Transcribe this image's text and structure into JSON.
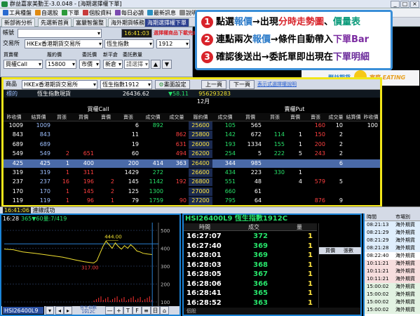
{
  "window": {
    "title": "群益嘉家美動王-3.0.048 - [海期選擇權下單]",
    "controls": [
      "_",
      "□",
      "×"
    ]
  },
  "menu": [
    {
      "label": "工具種盤",
      "color": "#2a6bd0"
    },
    {
      "label": "自選股",
      "color": "#e08a10"
    },
    {
      "label": "下單",
      "color": "#2c9a3a"
    },
    {
      "label": "個股資料",
      "color": "#c83a3a"
    },
    {
      "label": "每日必讀",
      "color": "#7a4ab0"
    },
    {
      "label": "最新訊息",
      "color": "#2a8fbf"
    },
    {
      "label": "說明",
      "color": "#888888"
    },
    {
      "label": "頁面",
      "color": "#3a7ad0"
    },
    {
      "label": "超光速下單",
      "color": "#d8232a"
    }
  ],
  "toolbar": [
    "☆",
    "雲端",
    "🔳",
    "☆"
  ],
  "tabs": [
    "新部術分析",
    "先選新首頁",
    "富嚴智盤整",
    "海外期貨帳務",
    "海期選擇權下單"
  ],
  "order": {
    "account_label": "帳號",
    "account_value": "",
    "exchange_label": "交易所",
    "exchange_value": "HKEx香港期貨交易所",
    "product_label": "恆生指數",
    "month_value": "1912",
    "warning": "選擇權商品下載完成",
    "time": "16:41:03",
    "col_labels": [
      "買賣權",
      "履約價",
      "委託價",
      "新平倉",
      "委託數量"
    ],
    "side": "買權Call",
    "strike": "15800",
    "price_type": "市價",
    "offset": "新倉",
    "qty_placeholder": "請選擇"
  },
  "tip": {
    "lines": [
      {
        "n": "1",
        "pre": "點選",
        "hl1": "報價",
        "mid": "→出現",
        "hl2": "分時走勢圖",
        "sep": "、",
        "hl3": "價量表",
        "post": ""
      },
      {
        "n": "2",
        "pre": "連點兩次",
        "hl1": "報價",
        "mid": "→條件自動帶入",
        "hl2": "下單Bar",
        "sep": "",
        "hl3": "",
        "post": ""
      },
      {
        "n": "3",
        "pre": "確認後送出→委託單即出現在",
        "hl1": "下單明細",
        "mid": "",
        "hl2": "",
        "sep": "",
        "hl3": "",
        "post": ""
      }
    ]
  },
  "brand": {
    "left": "群益期貨",
    "right": "富庭",
    "eat": "EATING"
  },
  "quote": {
    "prod_label": "商品",
    "exchange": "HKEx香港期貨交易所",
    "index_name": "恆生指數1912",
    "settings": "畫面設定",
    "prev": "上一頁",
    "next": "下一頁",
    "expand": "表示式選擇權說明",
    "underlying_label": "標的",
    "underlying_name": "恆生指數現貨",
    "underlying_price": "26436.62",
    "underlying_chg": "▼58.11",
    "underlying_vol": "956293283",
    "month": "12月",
    "call_label": "買權Call",
    "put_label": "賣權Put",
    "headers": [
      "昨收價",
      "結算價",
      "買張",
      "買價",
      "賣價",
      "賣張",
      "成交價",
      "成交量",
      "履約價",
      "成交價",
      "買價",
      "買張",
      "賣價",
      "賣張",
      "成交量",
      "結算價",
      "昨收價"
    ],
    "rows": [
      {
        "a": "1009",
        "b": "1009",
        "c": "",
        "d": "",
        "e": "",
        "f": "6",
        "g": "892",
        "h": "",
        "strike": "25600",
        "i": "105",
        "j": "565",
        "k": "",
        "l": "",
        "m": "160",
        "n": "10",
        "o": "",
        "p": "100",
        "q": "100"
      },
      {
        "a": "843",
        "b": "843",
        "c": "",
        "d": "",
        "e": "",
        "f": "11",
        "g": "",
        "h": "862",
        "strike": "25800",
        "i": "142",
        "j": "672",
        "k": "114",
        "l": "1",
        "m": "150",
        "n": "2",
        "o": "",
        "p": "",
        "q": "142"
      },
      {
        "a": "689",
        "b": "689",
        "c": "",
        "d": "",
        "e": "",
        "f": "19",
        "g": "",
        "h": "631",
        "strike": "26000",
        "i": "193",
        "j": "1334",
        "k": "155",
        "l": "1",
        "m": "200",
        "n": "2",
        "o": "",
        "p": "",
        "q": "193"
      },
      {
        "a": "549",
        "b": "549",
        "c": "2",
        "d": "651",
        "e": "",
        "f": "60",
        "g": "",
        "h": "494",
        "strike": "26200",
        "i": "254",
        "j": "5",
        "k": "222",
        "l": "5",
        "m": "243",
        "n": "2",
        "o": "",
        "p": "",
        "q": "254"
      },
      {
        "a": "425",
        "b": "425",
        "c": "1",
        "d": "400",
        "e": "",
        "f": "200",
        "g": "414",
        "h": "363",
        "strike": "26400",
        "i": "344",
        "j": "985",
        "k": "",
        "l": "",
        "m": "",
        "n": "6",
        "o": "",
        "p": "",
        "q": "310"
      },
      {
        "a": "319",
        "b": "319",
        "c": "1",
        "d": "311",
        "e": "",
        "f": "1429",
        "g": "272",
        "h": "",
        "strike": "26600",
        "i": "434",
        "j": "223",
        "k": "330",
        "l": "1",
        "m": "",
        "n": "",
        "o": "",
        "p": "",
        "q": "434"
      },
      {
        "a": "237",
        "b": "237",
        "c": "16",
        "d": "196",
        "e": "2",
        "f": "145",
        "g": "1142",
        "h": "192",
        "strike": "26800",
        "i": "551",
        "j": "48",
        "k": "",
        "l": "4",
        "m": "579",
        "n": "5",
        "o": "",
        "p": "",
        "q": "525"
      },
      {
        "a": "170",
        "b": "170",
        "c": "1",
        "d": "145",
        "e": "2",
        "f": "125",
        "g": "1300",
        "h": "",
        "strike": "27000",
        "i": "660",
        "j": "61",
        "k": "",
        "l": "",
        "m": "",
        "n": "",
        "o": "",
        "p": "",
        "q": "660"
      },
      {
        "a": "119",
        "b": "119",
        "c": "1",
        "d": "96",
        "e": "1",
        "f": "79",
        "g": "1759",
        "h": "90",
        "strike": "27200",
        "i": "795",
        "j": "64",
        "k": "",
        "l": "",
        "m": "876",
        "n": "9",
        "o": "",
        "p": "",
        "q": "805"
      }
    ]
  },
  "status": {
    "time": "16:41:06",
    "text": "連線成功"
  },
  "chart": {
    "header_time": "16:28",
    "header_info": "365▼60量:7/419",
    "high_label": "444.00",
    "low_label": "317.00",
    "y_ticks": [
      "500",
      "400",
      "300",
      "200",
      "100"
    ],
    "symbol": "HSI26400L9",
    "index_name": "恆生指數",
    "index_month": "1912C",
    "zoom_buttons": [
      "—",
      "+",
      "T",
      "F",
      "≡",
      "日",
      "⌂"
    ]
  },
  "ticks": {
    "title": "HSI26400L9 恆生指數1912C",
    "headers": [
      "時間",
      "成交",
      "量"
    ],
    "rows": [
      {
        "t": "16:27:07",
        "p": "372",
        "v": "1"
      },
      {
        "t": "16:27:40",
        "p": "369",
        "v": "1"
      },
      {
        "t": "16:28:01",
        "p": "369",
        "v": "1"
      },
      {
        "t": "16:28:03",
        "p": "368",
        "v": "1"
      },
      {
        "t": "16:28:05",
        "p": "367",
        "v": "1"
      },
      {
        "t": "16:28:06",
        "p": "366",
        "v": "1"
      },
      {
        "t": "16:28:41",
        "p": "365",
        "v": "1"
      },
      {
        "t": "16:28:52",
        "p": "363",
        "v": "1"
      }
    ],
    "side_headers": [
      "買價",
      "張數"
    ],
    "bottom_label": "個股"
  },
  "side": {
    "headers": [
      "時間",
      "市場別"
    ],
    "rows": [
      {
        "t": "08:21:13",
        "m": "海外期貨",
        "c": "#dfeefc"
      },
      {
        "t": "08:21:29",
        "m": "海外期貨",
        "c": "#dfeefc"
      },
      {
        "t": "08:21:29",
        "m": "海外期貨",
        "c": "#dfeefc"
      },
      {
        "t": "08:21:28",
        "m": "海外期貨",
        "c": "#dfeefc"
      },
      {
        "t": "08:22:40",
        "m": "海外期貨",
        "c": "#ffffff"
      },
      {
        "t": "10:11:21",
        "m": "海外期貨",
        "c": "#f7dede"
      },
      {
        "t": "10:11:21",
        "m": "海外期貨",
        "c": "#f7dede"
      },
      {
        "t": "10:11:21",
        "m": "海外期貨",
        "c": "#f7dede"
      },
      {
        "t": "15:00:02",
        "m": "海外期貨",
        "c": "#e2f2e2"
      },
      {
        "t": "15:00:02",
        "m": "海外期貨",
        "c": "#e2f2e2"
      },
      {
        "t": "15:00:02",
        "m": "海外期貨",
        "c": "#e2f2e2"
      },
      {
        "t": "15:00:02",
        "m": "海外期貨",
        "c": "#e2f2e2"
      }
    ]
  }
}
